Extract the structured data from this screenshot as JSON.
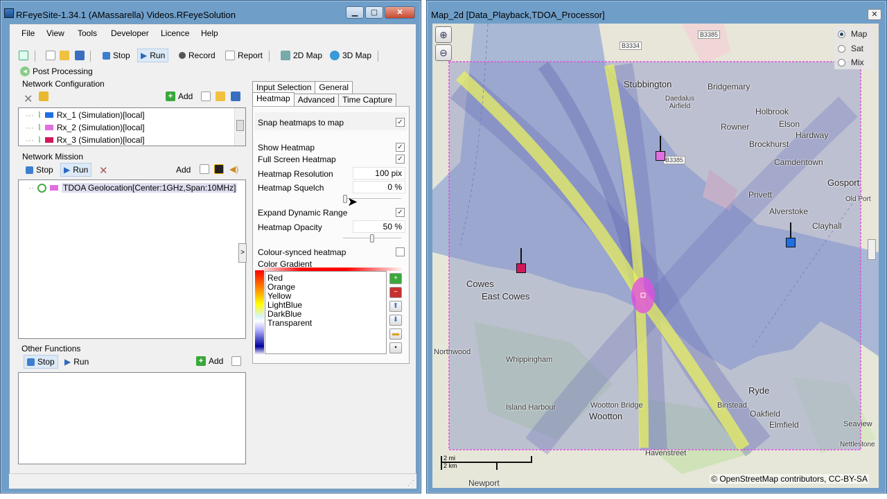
{
  "app": {
    "title": "RFeyeSite-1.34.1 (AMassarella) Videos.RFeyeSolution",
    "menu": [
      "File",
      "View",
      "Tools",
      "Developer",
      "Licence",
      "Help"
    ],
    "toolbar": {
      "stop": "Stop",
      "run": "Run",
      "record": "Record",
      "report": "Report",
      "map2d": "2D Map",
      "map3d": "3D Map"
    },
    "post_processing": "Post Processing",
    "network_config": {
      "label": "Network Configuration",
      "add": "Add",
      "items": [
        {
          "label": "Rx_1 (Simulation)[local]",
          "color": "#1f6fe0"
        },
        {
          "label": "Rx_2 (Simulation)[local]",
          "color": "#e070e0"
        },
        {
          "label": "Rx_3 (Simulation)[local]",
          "color": "#d0185a"
        }
      ]
    },
    "network_mission": {
      "label": "Network Mission",
      "stop": "Stop",
      "run": "Run",
      "add": "Add",
      "item": "TDOA Geolocation[Center:1GHz,Span:10MHz]"
    },
    "other_functions": {
      "label": "Other Functions",
      "stop": "Stop",
      "run": "Run",
      "add": "Add"
    },
    "tabs_top": [
      "Input Selection",
      "General"
    ],
    "tabs_bottom": [
      "Heatmap",
      "Advanced",
      "Time Capture"
    ],
    "heatmap": {
      "snap": "Snap heatmaps to map",
      "show": "Show Heatmap",
      "fullscreen": "Full Screen Heatmap",
      "resolution_label": "Heatmap Resolution",
      "resolution_value": "100 pix",
      "squelch_label": "Heatmap Squelch",
      "squelch_value": "0 %",
      "squelch_level": 0,
      "expand": "Expand Dynamic Range",
      "opacity_label": "Heatmap Opacity",
      "opacity_value": "50 %",
      "opacity_level": 0.5,
      "colour_synced": "Colour-synced heatmap",
      "gradient_label": "Color Gradient",
      "gradient_items": [
        "Red",
        "Orange",
        "Yellow",
        "LightBlue",
        "DarkBlue",
        "Transparent"
      ],
      "checks": {
        "snap": true,
        "show": true,
        "fullscreen": true,
        "expand": true,
        "colour_synced": false
      }
    }
  },
  "map": {
    "title": "Map_2d [Data_Playback,TDOA_Processor]",
    "modes": [
      {
        "label": "Map",
        "selected": true
      },
      {
        "label": "Sat",
        "selected": false
      },
      {
        "label": "Mix",
        "selected": false
      }
    ],
    "places": [
      "Stubbington",
      "Bridgemary",
      "Daedalus Airfield",
      "Holbrook",
      "Rowner",
      "Elson",
      "Hardway",
      "Brockhurst",
      "Camdentown",
      "Gosport",
      "Privett",
      "Alverstoke",
      "Clayhall",
      "Cowes",
      "East Cowes",
      "Whippingham",
      "Northwood",
      "Island Harbour",
      "Wootton Bridge",
      "Wootton",
      "Binstead",
      "Ryde",
      "Oakfield",
      "Elmfield",
      "Seaview",
      "Nettlestone",
      "Havenstreet",
      "Newport",
      "Old Port"
    ],
    "roads": [
      "B3385",
      "B3334",
      "B3385"
    ],
    "scale": {
      "mi": "2 mi",
      "km": "2 km"
    },
    "attribution": "© OpenStreetMap contributors, CC-BY-SA"
  }
}
